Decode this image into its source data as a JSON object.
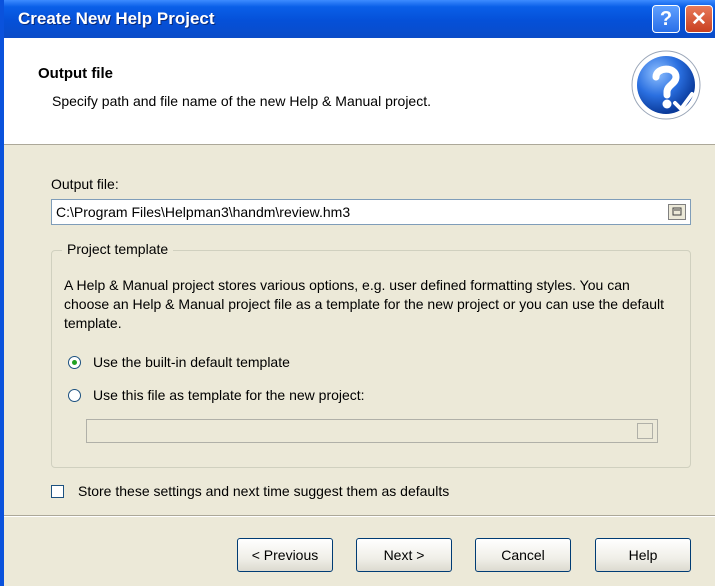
{
  "window": {
    "title": "Create New Help Project",
    "help_glyph": "?",
    "close_glyph": "✕"
  },
  "header": {
    "title": "Output file",
    "subtitle": "Specify path and file name of the new Help & Manual project.",
    "icon": "help-question-icon"
  },
  "output": {
    "label": "Output file:",
    "value": "C:\\Program Files\\Helpman3\\handm\\review.hm3"
  },
  "template_group": {
    "title": "Project template",
    "description": "A Help & Manual project stores various options, e.g. user defined formatting styles. You can choose an Help & Manual project file as a template for the new project or you can use the default template.",
    "options": [
      {
        "label": "Use the built-in default template",
        "selected": true
      },
      {
        "label": "Use this file as template for the new project:",
        "selected": false
      }
    ],
    "template_file_value": ""
  },
  "store_defaults": {
    "label": "Store these settings and next time suggest them as defaults",
    "checked": false
  },
  "buttons": {
    "previous": "< Previous",
    "next": "Next >",
    "cancel": "Cancel",
    "help": "Help"
  },
  "colors": {
    "titlebar": "#0550d8",
    "dialog_bg": "#ece9d8",
    "header_bg": "#ffffff",
    "icon_blue": "#1f5bc8"
  }
}
